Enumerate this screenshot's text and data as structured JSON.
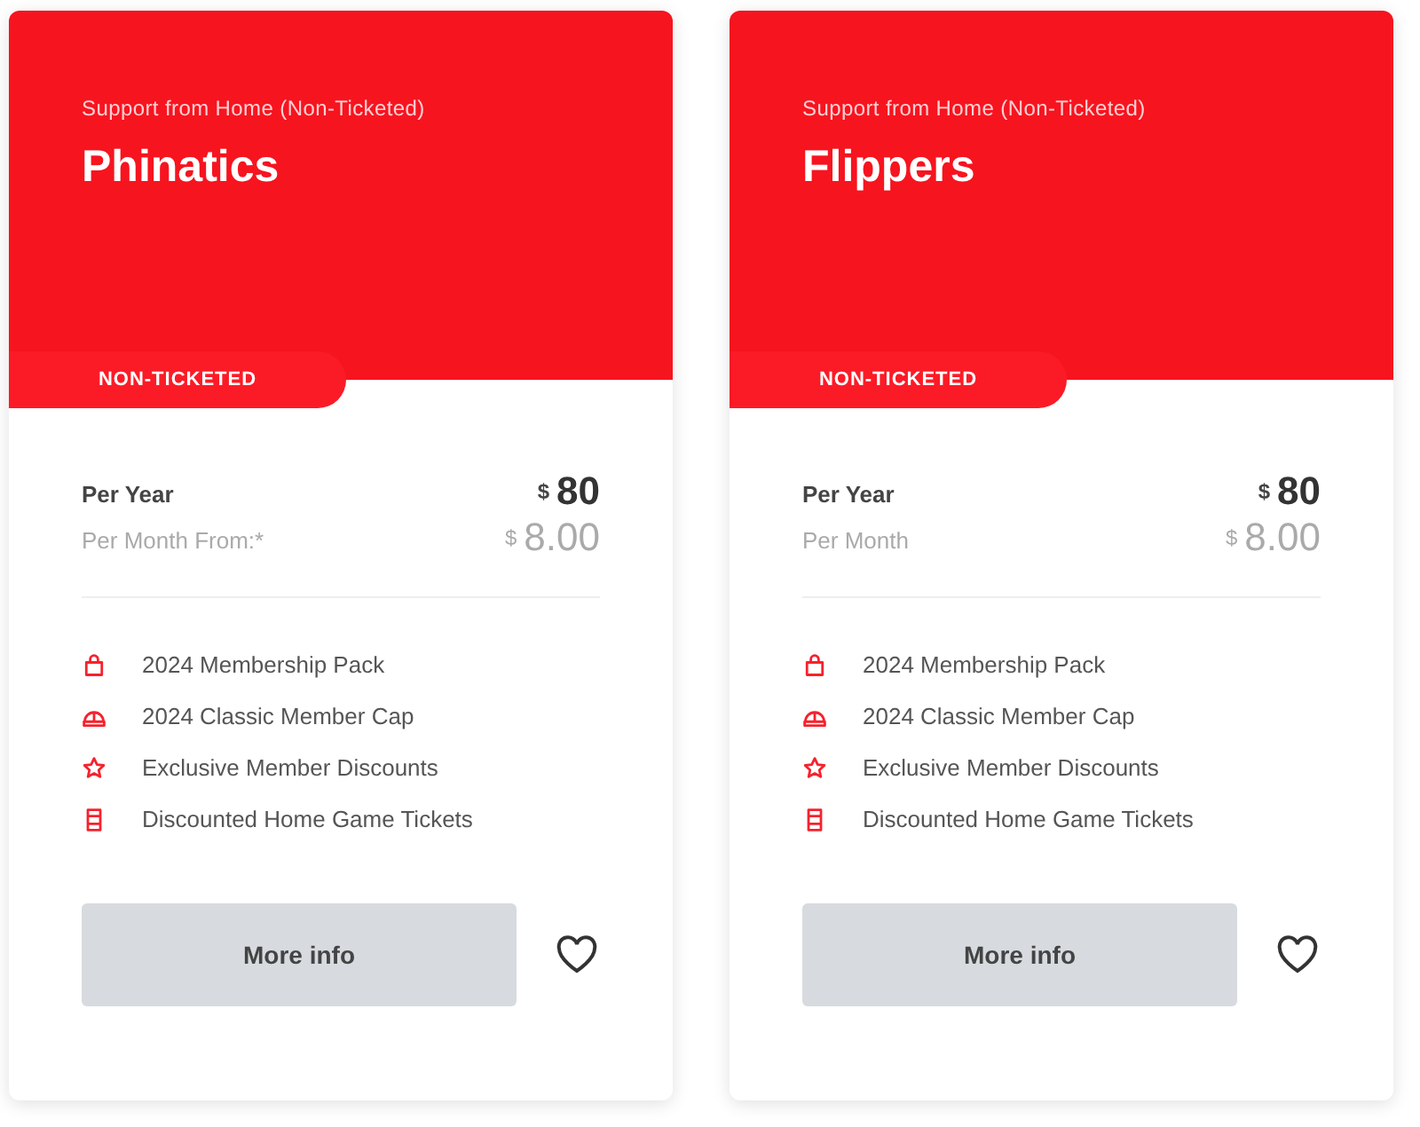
{
  "cards": [
    {
      "category": "Support from Home (Non-Ticketed)",
      "title": "Phinatics",
      "tag": "NON-TICKETED",
      "price_year_label": "Per Year",
      "price_year_currency": "$",
      "price_year": "80",
      "price_month_label": "Per Month From:*",
      "price_month_currency": "$",
      "price_month": "8.00",
      "features": [
        {
          "kind": "bag",
          "text": "2024 Membership Pack"
        },
        {
          "kind": "cap",
          "text": "2024 Classic Member Cap"
        },
        {
          "kind": "star",
          "text": "Exclusive Member Discounts"
        },
        {
          "kind": "ticket",
          "text": "Discounted Home Game Tickets"
        }
      ],
      "button": "More info"
    },
    {
      "category": "Support from Home (Non-Ticketed)",
      "title": "Flippers",
      "tag": "NON-TICKETED",
      "price_year_label": "Per Year",
      "price_year_currency": "$",
      "price_year": "80",
      "price_month_label": "Per Month",
      "price_month_currency": "$",
      "price_month": "8.00",
      "features": [
        {
          "kind": "bag",
          "text": "2024 Membership Pack"
        },
        {
          "kind": "cap",
          "text": "2024 Classic Member Cap"
        },
        {
          "kind": "star",
          "text": "Exclusive Member Discounts"
        },
        {
          "kind": "ticket",
          "text": "Discounted Home Game Tickets"
        }
      ],
      "button": "More info"
    }
  ]
}
